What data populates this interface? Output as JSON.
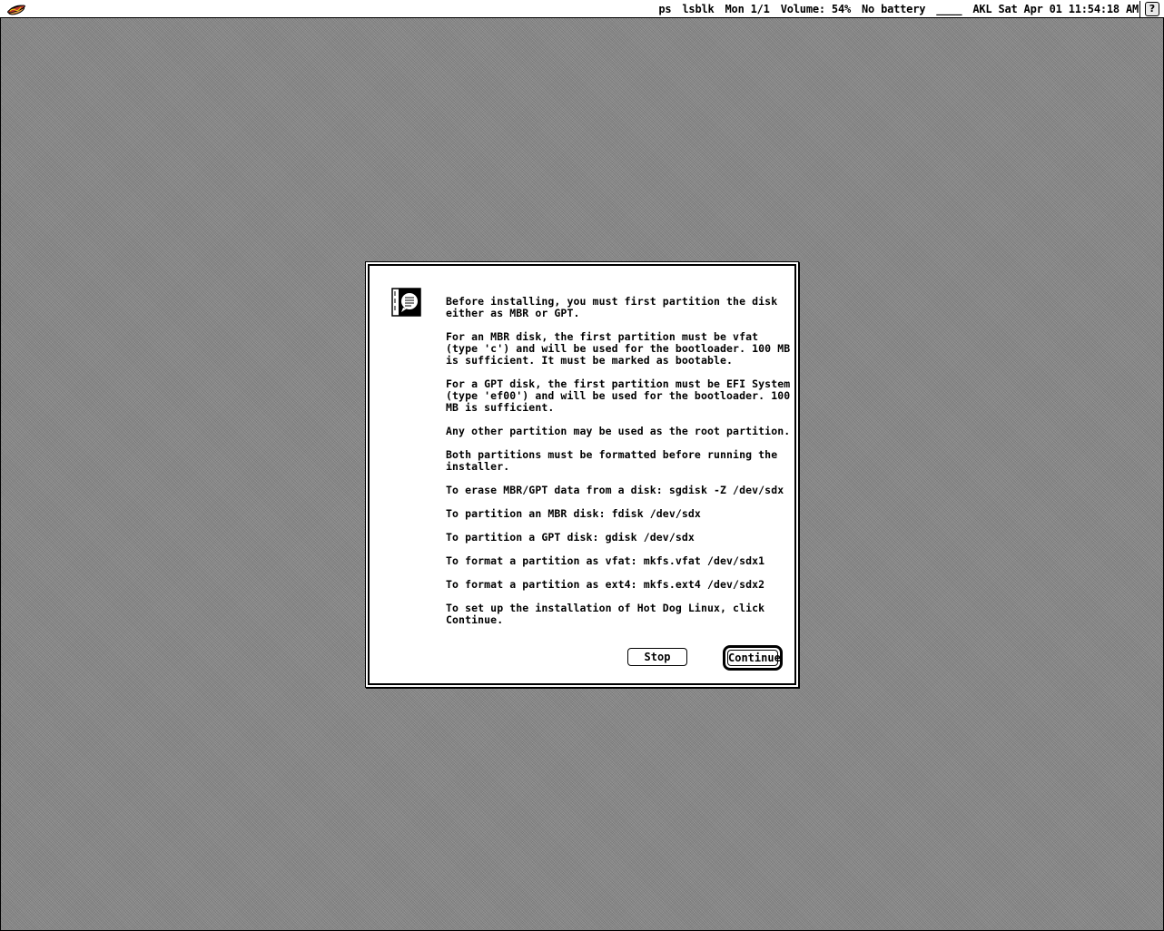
{
  "menubar": {
    "apple_menu_icon": "hotdog-icon",
    "items": [
      "ps",
      "lsblk",
      "Mon 1/1",
      "Volume: 54%",
      "No battery",
      "____",
      "AKL Sat Apr 01 11:54:18 AM"
    ],
    "help_icon": "help-icon",
    "help_label": "?"
  },
  "dialog": {
    "icon": "installer-document-icon",
    "paragraphs": [
      "Before installing, you must first partition the disk either as MBR or GPT.",
      "For an MBR disk, the first partition must be vfat (type 'c') and will be used for the bootloader. 100 MB is sufficient. It must be marked as bootable.",
      "For a GPT disk, the first partition must be EFI System (type 'ef00') and will be used for the bootloader. 100 MB is sufficient.",
      "Any other partition may be used as the root partition.",
      "Both partitions must be formatted before running the installer.",
      "To erase MBR/GPT data from a disk: sgdisk -Z /dev/sdx",
      "To partition an MBR disk: fdisk /dev/sdx",
      "To partition a GPT disk: gdisk /dev/sdx",
      "To format a partition as vfat: mkfs.vfat /dev/sdx1",
      "To format a partition as ext4: mkfs.ext4 /dev/sdx2",
      "To set up the installation of Hot Dog Linux, click Continue."
    ],
    "buttons": {
      "stop": "Stop",
      "continue": "Continue"
    }
  },
  "colors": {
    "desktop": "#8a8a8a",
    "window": "#ffffff",
    "ink": "#000000",
    "hotdog_bun": "#e8a050",
    "hotdog_sausage": "#c0392b"
  }
}
